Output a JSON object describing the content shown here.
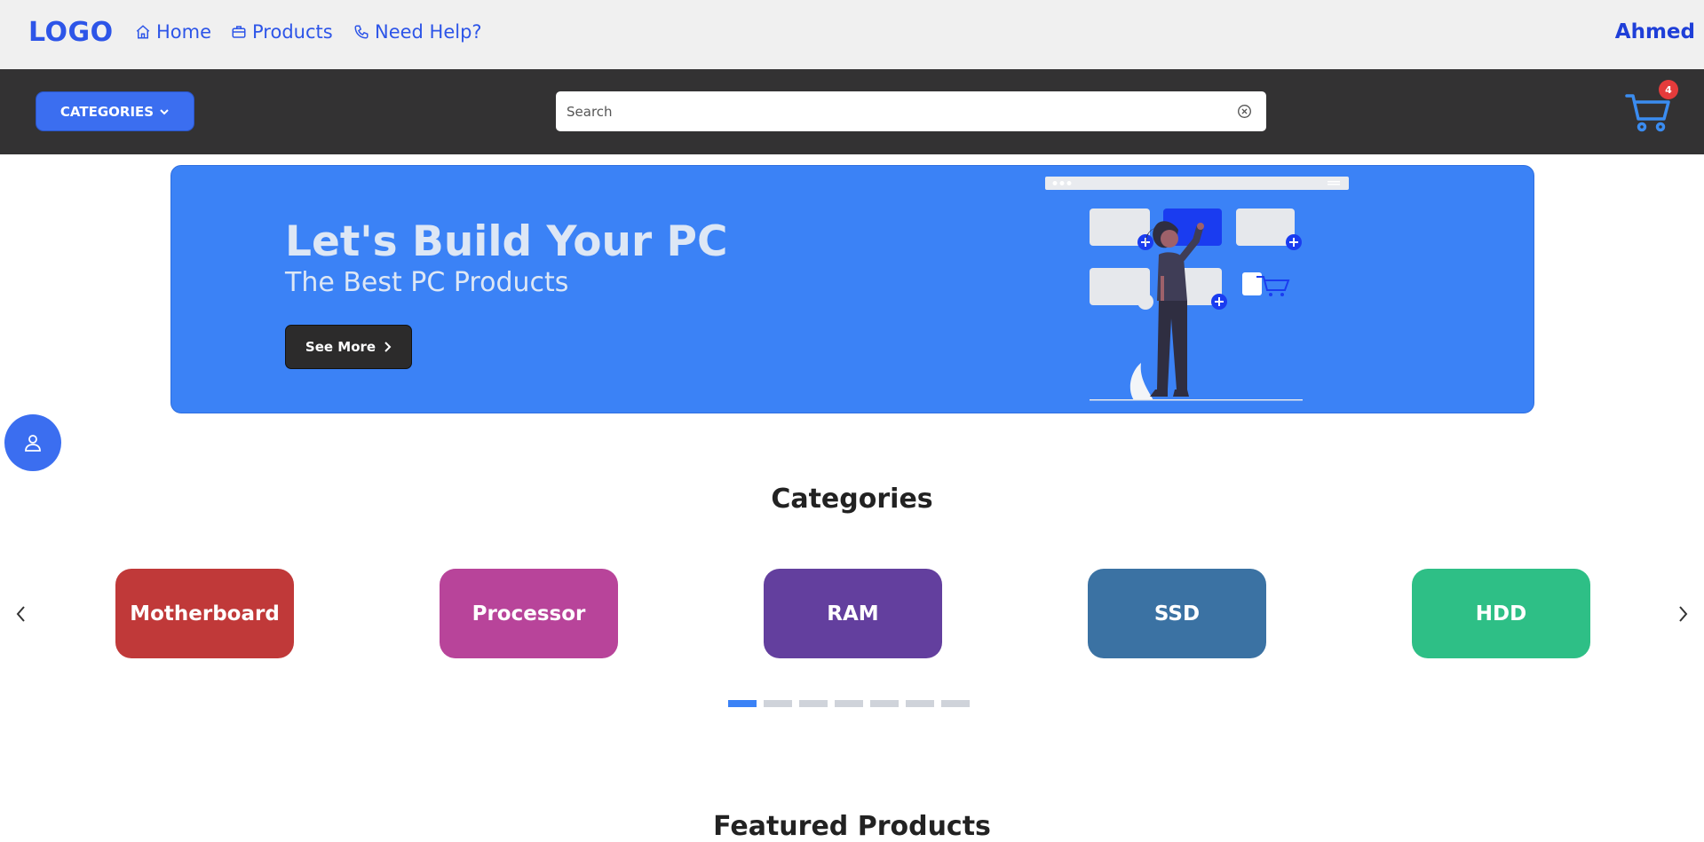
{
  "header": {
    "logo": "LOGO",
    "nav": [
      {
        "label": "Home",
        "icon": "home-icon"
      },
      {
        "label": "Products",
        "icon": "briefcase-icon"
      },
      {
        "label": "Need Help?",
        "icon": "phone-icon"
      }
    ],
    "user_name": "Ahmed"
  },
  "toolbar": {
    "categories_label": "CATEGORIES",
    "search_placeholder": "Search",
    "cart_count": "4"
  },
  "banner": {
    "title": "Let's Build Your PC",
    "subtitle": "The Best PC Products",
    "button_label": "See More"
  },
  "categories": {
    "title": "Categories",
    "items": [
      {
        "label": "Motherboard",
        "color": "#c03939"
      },
      {
        "label": "Processor",
        "color": "#b8449a"
      },
      {
        "label": "RAM",
        "color": "#633f9e"
      },
      {
        "label": "SSD",
        "color": "#3b72a3"
      },
      {
        "label": "HDD",
        "color": "#2ebf86"
      }
    ],
    "carousel": {
      "page_count": 7,
      "active_page": 1
    }
  },
  "featured": {
    "title": "Featured Products"
  },
  "colors": {
    "accent": "#3b82f6",
    "nav_text": "#2d55e8",
    "dark_bar": "#333233",
    "badge": "#e53b3b"
  }
}
